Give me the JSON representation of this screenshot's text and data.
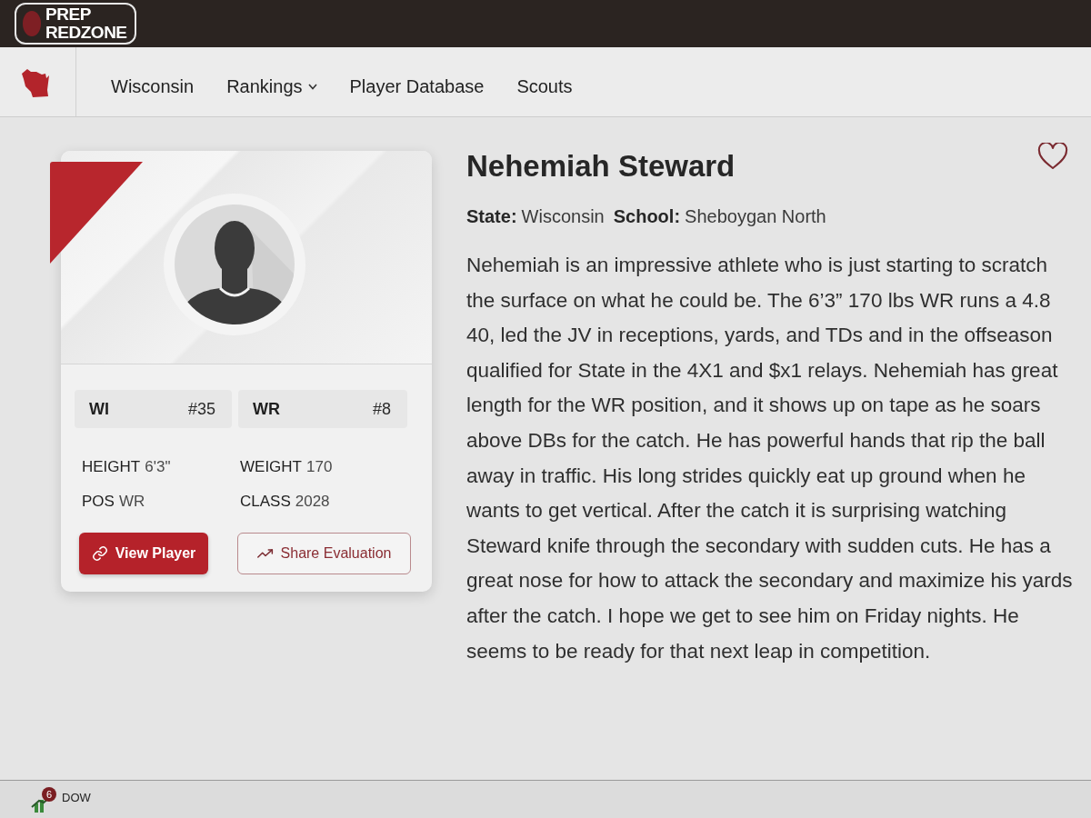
{
  "header": {
    "logo": [
      "PREP",
      "REDZONE"
    ]
  },
  "nav": {
    "items": [
      {
        "label": "Wisconsin",
        "dropdown": false
      },
      {
        "label": "Rankings",
        "dropdown": true
      },
      {
        "label": "Player Database",
        "dropdown": false
      },
      {
        "label": "Scouts",
        "dropdown": false
      }
    ]
  },
  "player_card": {
    "rankings": [
      {
        "label": "WI",
        "rank": "#35"
      },
      {
        "label": "WR",
        "rank": "#8"
      }
    ],
    "stats": [
      {
        "label": "HEIGHT",
        "value": "6'3\""
      },
      {
        "label": "WEIGHT",
        "value": "170"
      },
      {
        "label": "POS",
        "value": "WR"
      },
      {
        "label": "CLASS",
        "value": "2028"
      }
    ],
    "buttons": [
      {
        "label": "View Player",
        "kind": "primary"
      },
      {
        "label": "Share Evaluation",
        "kind": "secondary"
      }
    ]
  },
  "profile": {
    "name": "Nehemiah Steward",
    "favorite": false,
    "details": [
      {
        "label": "State:",
        "value": "Wisconsin"
      },
      {
        "label": "School:",
        "value": "Sheboygan North"
      }
    ],
    "evaluation": "Nehemiah is an impressive athlete who is just starting to scratch the surface on what he could be. The 6’3” 170 lbs WR runs a 4.8 40, led the JV in receptions, yards, and TDs and in the offseason qualified for State in the 4X1 and $x1 relays. Nehemiah has great length for the WR position, and it shows up on tape as he soars above DBs for the catch. He has powerful hands that rip the ball away in traffic. His long strides quickly eat up ground when he wants to get vertical. After the catch it is surprising watching Steward knife through the secondary with sudden cuts. He has a great nose for how to attack the secondary and maximize his yards after the catch. I hope we get to see him on Friday nights. He seems to be ready for that next leap in competition."
  },
  "taskbar": {
    "widget": {
      "label": "DOW",
      "badge": "6"
    }
  }
}
